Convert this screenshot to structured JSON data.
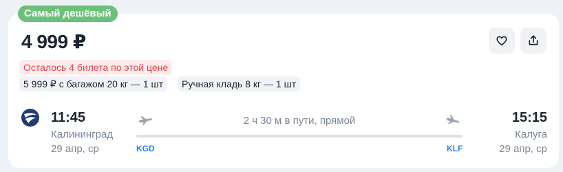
{
  "colors": {
    "badge_green": "#6cc17a",
    "warn_text": "#e0424a",
    "warn_bg": "#fdecec",
    "iata_blue": "#2e7fe0",
    "airline_logo_blue": "#1f3b78"
  },
  "badge": {
    "label": "Самый дешёвый"
  },
  "offer": {
    "price": "4 999 ₽",
    "seats_left": "Осталось 4 билета по этой цене",
    "baggage_option": "5 999 ₽ с багажом 20 кг — 1 шт",
    "hand_luggage": "Ручная кладь 8 кг — 1 шт"
  },
  "actions": [
    {
      "icon": "heart-icon",
      "label": "favorite"
    },
    {
      "icon": "share-icon",
      "label": "share"
    }
  ],
  "flight": {
    "airline_icon": "airline-logo-icon",
    "duration": "2 ч 30 м в пути, прямой",
    "departure": {
      "time": "11:45",
      "city": "Калининград",
      "date": "29 апр, ср",
      "iata": "KGD"
    },
    "arrival": {
      "time": "15:15",
      "city": "Калуга",
      "date": "29 апр, ср",
      "iata": "KLF"
    }
  }
}
